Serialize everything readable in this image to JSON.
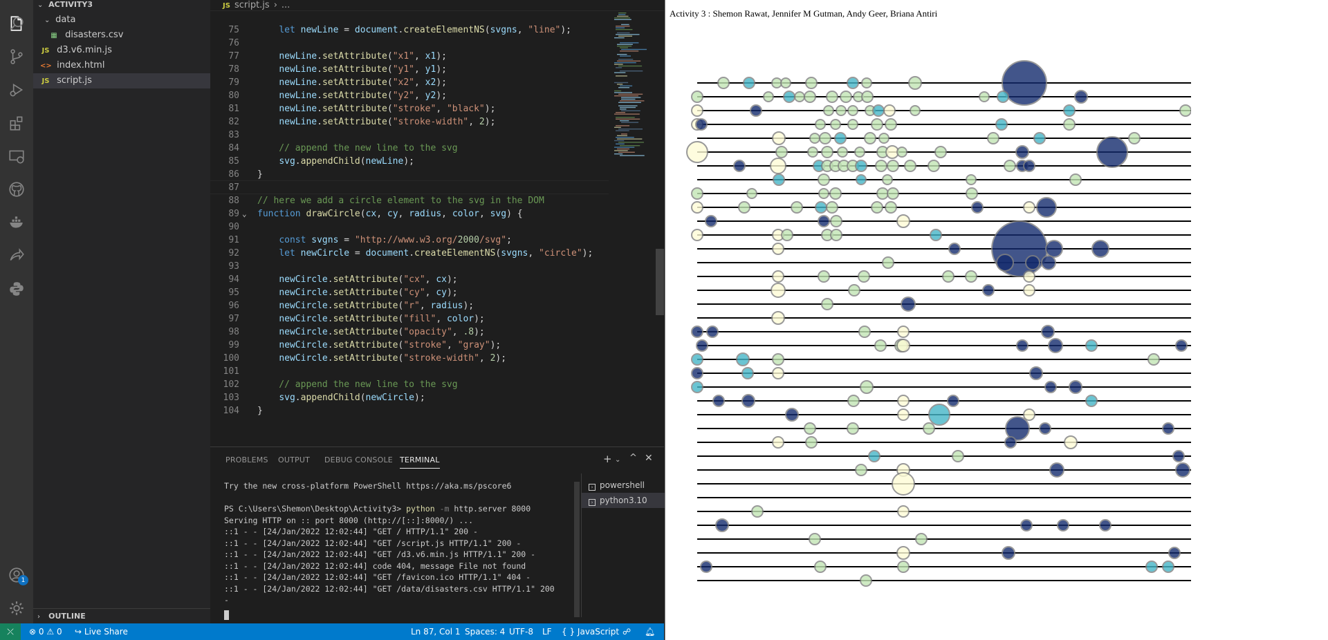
{
  "explorer": {
    "project": "ACTIVITY3",
    "items": [
      {
        "type": "folder",
        "label": "data"
      },
      {
        "type": "csv",
        "label": "disasters.csv"
      },
      {
        "type": "js",
        "label": "d3.v6.min.js"
      },
      {
        "type": "html",
        "label": "index.html"
      },
      {
        "type": "js",
        "label": "script.js"
      }
    ],
    "outline_label": "OUTLINE"
  },
  "editor": {
    "tab_file": "script.js",
    "tab_breadcrumb": "...",
    "lines": [
      {
        "n": "75",
        "t": "    let newLine = document.createElementNS(svgns, \"line\");"
      },
      {
        "n": "76",
        "t": ""
      },
      {
        "n": "77",
        "t": "    newLine.setAttribute(\"x1\", x1);"
      },
      {
        "n": "78",
        "t": "    newLine.setAttribute(\"y1\", y1);"
      },
      {
        "n": "79",
        "t": "    newLine.setAttribute(\"x2\", x2);"
      },
      {
        "n": "80",
        "t": "    newLine.setAttribute(\"y2\", y2);"
      },
      {
        "n": "81",
        "t": "    newLine.setAttribute(\"stroke\", \"black\");"
      },
      {
        "n": "82",
        "t": "    newLine.setAttribute(\"stroke-width\", 2);"
      },
      {
        "n": "83",
        "t": ""
      },
      {
        "n": "84",
        "t": "    // append the new line to the svg"
      },
      {
        "n": "85",
        "t": "    svg.appendChild(newLine);"
      },
      {
        "n": "86",
        "t": "}"
      },
      {
        "n": "87",
        "t": ""
      },
      {
        "n": "88",
        "t": "// here we add a circle element to the svg in the DOM"
      },
      {
        "n": "89",
        "t": "function drawCircle(cx, cy, radius, color, svg) {"
      },
      {
        "n": "90",
        "t": ""
      },
      {
        "n": "91",
        "t": "    const svgns = \"http://www.w3.org/2000/svg\";"
      },
      {
        "n": "92",
        "t": "    let newCircle = document.createElementNS(svgns, \"circle\");"
      },
      {
        "n": "93",
        "t": ""
      },
      {
        "n": "94",
        "t": "    newCircle.setAttribute(\"cx\", cx);"
      },
      {
        "n": "95",
        "t": "    newCircle.setAttribute(\"cy\", cy);"
      },
      {
        "n": "96",
        "t": "    newCircle.setAttribute(\"r\", radius);"
      },
      {
        "n": "97",
        "t": "    newCircle.setAttribute(\"fill\", color);"
      },
      {
        "n": "98",
        "t": "    newCircle.setAttribute(\"opacity\", .8);"
      },
      {
        "n": "99",
        "t": "    newCircle.setAttribute(\"stroke\", \"gray\");"
      },
      {
        "n": "100",
        "t": "    newCircle.setAttribute(\"stroke-width\", 2);"
      },
      {
        "n": "101",
        "t": ""
      },
      {
        "n": "102",
        "t": "    // append the new line to the svg"
      },
      {
        "n": "103",
        "t": "    svg.appendChild(newCircle);"
      },
      {
        "n": "104",
        "t": "}"
      }
    ]
  },
  "panel": {
    "tabs": [
      "PROBLEMS",
      "OUTPUT",
      "DEBUG CONSOLE",
      "TERMINAL"
    ],
    "active_tab": "TERMINAL",
    "terminal_lines": [
      "Try the new cross-platform PowerShell https://aka.ms/pscore6",
      "",
      "PS C:\\Users\\Shemon\\Desktop\\Activity3> python -m http.server 8000",
      "Serving HTTP on :: port 8000 (http://[::]:8000/) ...",
      "::1 - - [24/Jan/2022 12:02:44] \"GET / HTTP/1.1\" 200 -",
      "::1 - - [24/Jan/2022 12:02:44] \"GET /script.js HTTP/1.1\" 200 -",
      "::1 - - [24/Jan/2022 12:02:44] \"GET /d3.v6.min.js HTTP/1.1\" 200 -",
      "::1 - - [24/Jan/2022 12:02:44] code 404, message File not found",
      "::1 - - [24/Jan/2022 12:02:44] \"GET /favicon.ico HTTP/1.1\" 404 -",
      "::1 - - [24/Jan/2022 12:02:44] \"GET /data/disasters.csv HTTP/1.1\" 200",
      "-"
    ],
    "terminals": [
      "powershell",
      "python3.10"
    ],
    "selected_terminal": "python3.10"
  },
  "statusbar": {
    "errors": "0",
    "warnings": "0",
    "live_share": "Live Share",
    "position": "Ln 87, Col 1",
    "spaces": "Spaces: 4",
    "encoding": "UTF-8",
    "eol": "LF",
    "language_braces": "{ }",
    "language": "JavaScript"
  },
  "activity_badge": "1",
  "browser": {
    "title": "Activity 3 : Shemon Rawat, Jennifer M Gutman, Andy Geer, Briana Antiri"
  },
  "colors": {
    "light": "#fefcd6",
    "mint": "#c2e5b5",
    "teal": "#45b6c8",
    "navy": "#142b6e"
  },
  "chart_data": {
    "type": "scatter",
    "rows": 37,
    "x_range": [
      0,
      720
    ],
    "palette": [
      "#fefcd6",
      "#c2e5b5",
      "#45b6c8",
      "#142b6e"
    ],
    "circles": [
      [
        0,
        38,
        8,
        1
      ],
      [
        0,
        75,
        8,
        2
      ],
      [
        0,
        115,
        7,
        1
      ],
      [
        0,
        128,
        7,
        1
      ],
      [
        0,
        165,
        8,
        1
      ],
      [
        0,
        225,
        8,
        2
      ],
      [
        0,
        245,
        7,
        1
      ],
      [
        0,
        315,
        9,
        1
      ],
      [
        0,
        473,
        32,
        3
      ],
      [
        1,
        0,
        8,
        1
      ],
      [
        1,
        103,
        7,
        1
      ],
      [
        1,
        133,
        8,
        2
      ],
      [
        1,
        148,
        7,
        1
      ],
      [
        1,
        163,
        8,
        1
      ],
      [
        1,
        195,
        8,
        1
      ],
      [
        1,
        215,
        8,
        1
      ],
      [
        1,
        233,
        7,
        1
      ],
      [
        1,
        246,
        8,
        1
      ],
      [
        1,
        415,
        7,
        1
      ],
      [
        1,
        442,
        8,
        2
      ],
      [
        1,
        555,
        9,
        3
      ],
      [
        2,
        0,
        8,
        0
      ],
      [
        2,
        85,
        8,
        3
      ],
      [
        2,
        190,
        7,
        1
      ],
      [
        2,
        208,
        7,
        1
      ],
      [
        2,
        225,
        7,
        1
      ],
      [
        2,
        250,
        7,
        1
      ],
      [
        2,
        262,
        8,
        2
      ],
      [
        2,
        278,
        8,
        0
      ],
      [
        2,
        315,
        7,
        1
      ],
      [
        2,
        538,
        8,
        2
      ],
      [
        2,
        706,
        8,
        1
      ],
      [
        3,
        0,
        8,
        0
      ],
      [
        3,
        6,
        8,
        3
      ],
      [
        3,
        178,
        7,
        1
      ],
      [
        3,
        200,
        7,
        1
      ],
      [
        3,
        225,
        7,
        1
      ],
      [
        3,
        260,
        8,
        1
      ],
      [
        3,
        280,
        8,
        1
      ],
      [
        3,
        440,
        8,
        2
      ],
      [
        3,
        538,
        8,
        1
      ],
      [
        4,
        118,
        9,
        0
      ],
      [
        4,
        170,
        7,
        1
      ],
      [
        4,
        185,
        8,
        1
      ],
      [
        4,
        207,
        8,
        2
      ],
      [
        4,
        250,
        8,
        1
      ],
      [
        4,
        270,
        7,
        1
      ],
      [
        4,
        428,
        8,
        1
      ],
      [
        4,
        495,
        8,
        2
      ],
      [
        4,
        632,
        8,
        1
      ],
      [
        5,
        0,
        15,
        0
      ],
      [
        5,
        122,
        8,
        1
      ],
      [
        5,
        167,
        7,
        1
      ],
      [
        5,
        188,
        8,
        1
      ],
      [
        5,
        210,
        7,
        1
      ],
      [
        5,
        235,
        7,
        1
      ],
      [
        5,
        268,
        8,
        1
      ],
      [
        5,
        282,
        9,
        0
      ],
      [
        5,
        296,
        7,
        1
      ],
      [
        5,
        352,
        8,
        1
      ],
      [
        5,
        470,
        9,
        3
      ],
      [
        5,
        600,
        22,
        3
      ],
      [
        6,
        61,
        8,
        3
      ],
      [
        6,
        117,
        11,
        0
      ],
      [
        6,
        176,
        8,
        2
      ],
      [
        6,
        188,
        8,
        1
      ],
      [
        6,
        200,
        8,
        1
      ],
      [
        6,
        212,
        8,
        1
      ],
      [
        6,
        225,
        8,
        1
      ],
      [
        6,
        237,
        8,
        2
      ],
      [
        6,
        266,
        8,
        1
      ],
      [
        6,
        283,
        8,
        1
      ],
      [
        6,
        308,
        8,
        1
      ],
      [
        6,
        342,
        8,
        1
      ],
      [
        6,
        452,
        8,
        1
      ],
      [
        6,
        470,
        8,
        3
      ],
      [
        6,
        480,
        8,
        3
      ],
      [
        7,
        118,
        8,
        2
      ],
      [
        7,
        183,
        8,
        1
      ],
      [
        7,
        237,
        7,
        2
      ],
      [
        7,
        275,
        7,
        1
      ],
      [
        7,
        396,
        7,
        1
      ],
      [
        7,
        547,
        8,
        1
      ],
      [
        8,
        0,
        8,
        1
      ],
      [
        8,
        79,
        7,
        1
      ],
      [
        8,
        183,
        7,
        1
      ],
      [
        8,
        200,
        8,
        1
      ],
      [
        8,
        268,
        8,
        1
      ],
      [
        8,
        283,
        8,
        1
      ],
      [
        8,
        397,
        8,
        1
      ],
      [
        9,
        0,
        8,
        0
      ],
      [
        9,
        68,
        8,
        1
      ],
      [
        9,
        144,
        8,
        1
      ],
      [
        9,
        179,
        8,
        2
      ],
      [
        9,
        195,
        8,
        1
      ],
      [
        9,
        280,
        8,
        1
      ],
      [
        9,
        260,
        8,
        1
      ],
      [
        9,
        405,
        8,
        3
      ],
      [
        9,
        480,
        8,
        0
      ],
      [
        9,
        505,
        14,
        3
      ],
      [
        10,
        20,
        8,
        3
      ],
      [
        10,
        183,
        8,
        3
      ],
      [
        10,
        201,
        8,
        1
      ],
      [
        10,
        298,
        9,
        0
      ],
      [
        11,
        0,
        8,
        0
      ],
      [
        11,
        117,
        8,
        0
      ],
      [
        11,
        130,
        8,
        1
      ],
      [
        11,
        188,
        8,
        1
      ],
      [
        11,
        201,
        8,
        1
      ],
      [
        11,
        345,
        8,
        2
      ],
      [
        12,
        117,
        8,
        0
      ],
      [
        12,
        372,
        8,
        3
      ],
      [
        12,
        466,
        40,
        3
      ],
      [
        12,
        516,
        12,
        3
      ],
      [
        12,
        583,
        12,
        3
      ],
      [
        13,
        276,
        8,
        1
      ],
      [
        13,
        445,
        12,
        3
      ],
      [
        13,
        485,
        10,
        3
      ],
      [
        13,
        508,
        10,
        3
      ],
      [
        14,
        117,
        8,
        0
      ],
      [
        14,
        183,
        8,
        1
      ],
      [
        14,
        241,
        8,
        1
      ],
      [
        14,
        363,
        8,
        1
      ],
      [
        14,
        396,
        8,
        1
      ],
      [
        14,
        480,
        8,
        0
      ],
      [
        15,
        117,
        10,
        0
      ],
      [
        15,
        227,
        8,
        1
      ],
      [
        15,
        421,
        8,
        3
      ],
      [
        15,
        480,
        8,
        0
      ],
      [
        16,
        188,
        8,
        1
      ],
      [
        16,
        305,
        10,
        3
      ],
      [
        17,
        117,
        9,
        0
      ],
      [
        18,
        0,
        8,
        3
      ],
      [
        18,
        22,
        8,
        3
      ],
      [
        18,
        242,
        8,
        1
      ],
      [
        18,
        298,
        8,
        0
      ],
      [
        18,
        507,
        9,
        3
      ],
      [
        19,
        7,
        8,
        3
      ],
      [
        19,
        265,
        8,
        1
      ],
      [
        19,
        295,
        9,
        1
      ],
      [
        19,
        298,
        9,
        0
      ],
      [
        19,
        470,
        8,
        3
      ],
      [
        19,
        518,
        10,
        3
      ],
      [
        19,
        570,
        8,
        2
      ],
      [
        19,
        700,
        8,
        3
      ],
      [
        20,
        0,
        8,
        2
      ],
      [
        20,
        66,
        9,
        2
      ],
      [
        20,
        117,
        8,
        1
      ],
      [
        20,
        660,
        8,
        1
      ],
      [
        21,
        0,
        8,
        3
      ],
      [
        21,
        73,
        8,
        2
      ],
      [
        21,
        117,
        8,
        0
      ],
      [
        21,
        490,
        9,
        3
      ],
      [
        22,
        0,
        8,
        2
      ],
      [
        22,
        245,
        9,
        1
      ],
      [
        22,
        511,
        8,
        3
      ],
      [
        22,
        547,
        9,
        3
      ],
      [
        23,
        31,
        8,
        3
      ],
      [
        23,
        74,
        9,
        3
      ],
      [
        23,
        226,
        8,
        1
      ],
      [
        23,
        298,
        8,
        0
      ],
      [
        23,
        370,
        8,
        3
      ],
      [
        23,
        570,
        8,
        2
      ],
      [
        24,
        137,
        9,
        3
      ],
      [
        24,
        298,
        8,
        0
      ],
      [
        24,
        350,
        15,
        2
      ],
      [
        24,
        480,
        8,
        0
      ],
      [
        25,
        163,
        8,
        1
      ],
      [
        25,
        225,
        8,
        1
      ],
      [
        25,
        335,
        8,
        1
      ],
      [
        25,
        463,
        17,
        3
      ],
      [
        25,
        503,
        8,
        3
      ],
      [
        25,
        681,
        8,
        3
      ],
      [
        26,
        117,
        8,
        0
      ],
      [
        26,
        165,
        8,
        1
      ],
      [
        26,
        453,
        8,
        3
      ],
      [
        26,
        540,
        9,
        0
      ],
      [
        27,
        256,
        8,
        2
      ],
      [
        27,
        377,
        8,
        1
      ],
      [
        27,
        696,
        8,
        3
      ],
      [
        28,
        237,
        8,
        1
      ],
      [
        28,
        298,
        9,
        0
      ],
      [
        28,
        520,
        10,
        3
      ],
      [
        28,
        702,
        10,
        3
      ],
      [
        29,
        298,
        16,
        0
      ],
      [
        31,
        87,
        8,
        1
      ],
      [
        31,
        298,
        8,
        0
      ],
      [
        32,
        36,
        9,
        3
      ],
      [
        32,
        476,
        8,
        3
      ],
      [
        32,
        529,
        8,
        3
      ],
      [
        32,
        590,
        8,
        3
      ],
      [
        33,
        170,
        8,
        1
      ],
      [
        33,
        324,
        8,
        1
      ],
      [
        34,
        298,
        9,
        0
      ],
      [
        34,
        450,
        9,
        3
      ],
      [
        34,
        690,
        8,
        3
      ],
      [
        35,
        13,
        8,
        3
      ],
      [
        35,
        178,
        8,
        1
      ],
      [
        35,
        298,
        8,
        1
      ],
      [
        35,
        657,
        8,
        2
      ],
      [
        35,
        681,
        8,
        2
      ],
      [
        36,
        244,
        8,
        1
      ]
    ]
  }
}
